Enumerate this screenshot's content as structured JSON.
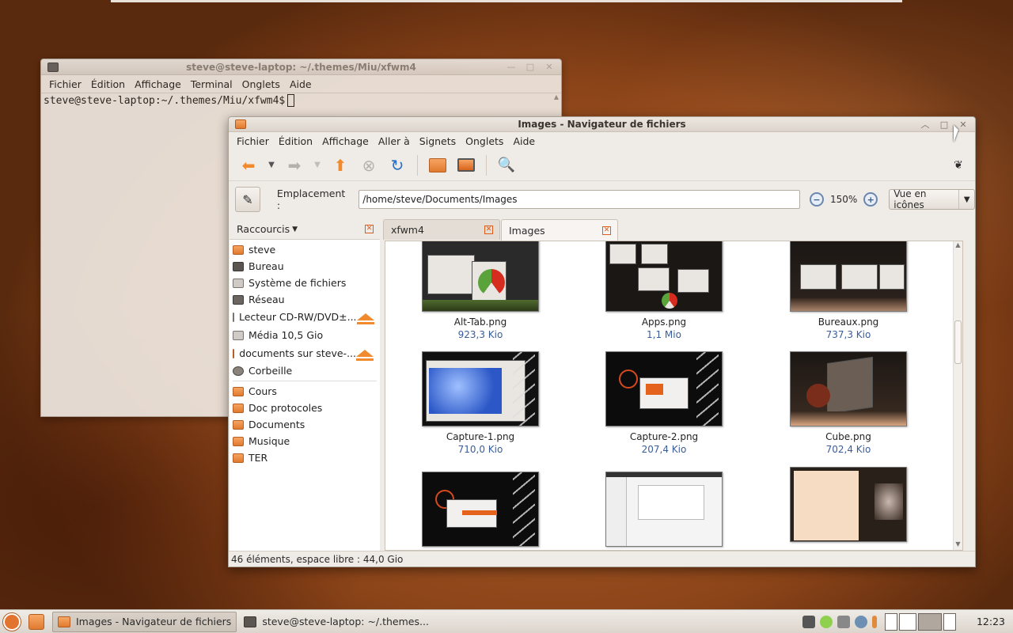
{
  "terminal": {
    "title": "steve@steve-laptop: ~/.themes/Miu/xfwm4",
    "menu": [
      "Fichier",
      "Édition",
      "Affichage",
      "Terminal",
      "Onglets",
      "Aide"
    ],
    "prompt": "steve@steve-laptop:~/.themes/Miu/xfwm4$"
  },
  "filemanager": {
    "title": "Images - Navigateur de fichiers",
    "menu": [
      "Fichier",
      "Édition",
      "Affichage",
      "Aller à",
      "Signets",
      "Onglets",
      "Aide"
    ],
    "location_label": "Emplacement :",
    "location_value": "/home/steve/Documents/Images",
    "zoom_level": "150%",
    "view_mode": "Vue en icônes",
    "sidebar": {
      "header": "Raccourcis",
      "places": [
        "steve",
        "Bureau",
        "Système de fichiers",
        "Réseau",
        "Lecteur CD-RW/DVD±...",
        "Média 10,5 Gio",
        "documents sur steve-...",
        "Corbeille"
      ],
      "bookmarks": [
        "Cours",
        "Doc protocoles",
        "Documents",
        "Musique",
        "TER"
      ]
    },
    "tabs": [
      "xfwm4",
      "Images"
    ],
    "files": [
      {
        "name": "Alt-Tab.png",
        "size": "923,3 Kio"
      },
      {
        "name": "Apps.png",
        "size": "1,1 Mio"
      },
      {
        "name": "Bureaux.png",
        "size": "737,3 Kio"
      },
      {
        "name": "Capture-1.png",
        "size": "710,0 Kio"
      },
      {
        "name": "Capture-2.png",
        "size": "207,4 Kio"
      },
      {
        "name": "Cube.png",
        "size": "702,4 Kio"
      }
    ],
    "status": "46 éléments, espace libre : 44,0 Gio"
  },
  "taskbar": {
    "tasks": [
      "Images - Navigateur de fichiers",
      "steve@steve-laptop: ~/.themes..."
    ],
    "clock": "12:23"
  },
  "colors": {
    "accent": "#f08a2c",
    "desktop": "#8a4318",
    "size_text": "#3a5d9a"
  }
}
